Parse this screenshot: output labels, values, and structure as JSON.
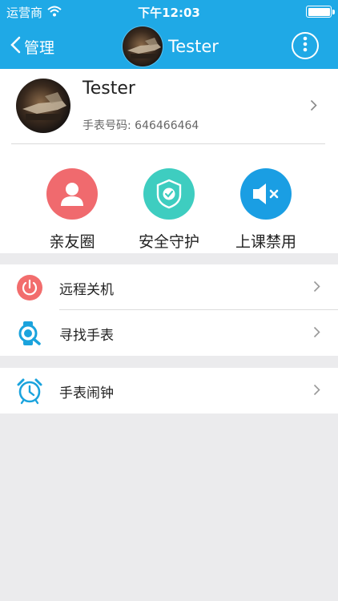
{
  "status_bar": {
    "carrier": "运营商",
    "time": "下午12:03"
  },
  "nav": {
    "back_label": "管理",
    "title": "Tester"
  },
  "profile": {
    "name": "Tester",
    "watch_number": "手表号码: 646466464"
  },
  "features": [
    {
      "label": "亲友圈",
      "color": "#f06a6e",
      "icon": "person-icon"
    },
    {
      "label": "安全守护",
      "color": "#3ecdc0",
      "icon": "shield-check-icon"
    },
    {
      "label": "上课禁用",
      "color": "#1a9ee3",
      "icon": "mute-speaker-icon"
    }
  ],
  "menu_group1": [
    {
      "label": "远程关机",
      "icon": "power-icon"
    },
    {
      "label": "寻找手表",
      "icon": "find-watch-icon"
    }
  ],
  "menu_group2": [
    {
      "label": "手表闹钟",
      "icon": "alarm-clock-icon"
    }
  ],
  "colors": {
    "brand_blue": "#1fa9e6",
    "background": "#ebebed"
  }
}
